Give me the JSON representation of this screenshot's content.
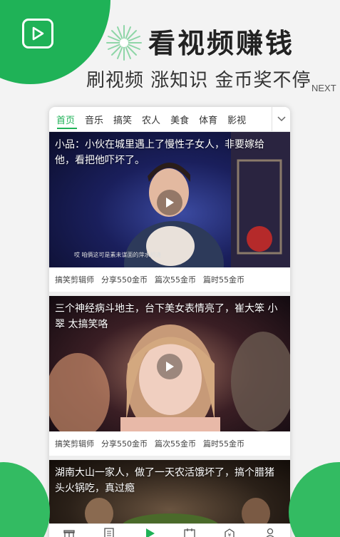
{
  "promo": {
    "headline": "看视频赚钱",
    "subline": "刷视频 涨知识 金币奖不停",
    "next_label": "NEXT"
  },
  "icons": {
    "app": "play-square-icon",
    "burst": "sparkle-burst-icon",
    "more": "chevron-down-icon",
    "play": "play-icon"
  },
  "colors": {
    "accent": "#1fb257",
    "text": "#333333"
  },
  "tabs": [
    {
      "label": "首页",
      "active": true
    },
    {
      "label": "音乐"
    },
    {
      "label": "搞笑"
    },
    {
      "label": "农人"
    },
    {
      "label": "美食"
    },
    {
      "label": "体育"
    },
    {
      "label": "影视"
    }
  ],
  "videos": [
    {
      "title": "小品：小伙在城里遇上了慢性子女人，非要嫁给他，看把他吓坏了。",
      "caption": "哎 咱俩这可是素未谋面的萍水相逢",
      "author": "搞笑剪辑师",
      "share": "分享550金币",
      "views": "篇次55金币",
      "duration": "篇时55金币"
    },
    {
      "title": "三个神经病斗地主，台下美女表情亮了，崔大笨 小翠 太搞笑咯",
      "author": "搞笑剪辑师",
      "share": "分享550金币",
      "views": "篇次55金币",
      "duration": "篇时55金币"
    },
    {
      "title": "湖南大山一家人，做了一天农活饿坏了，搞个腊猪头火锅吃，真过瘾"
    }
  ],
  "bottom_nav": [
    "gift-icon",
    "list-icon",
    "play-icon",
    "task-icon",
    "coin-icon",
    "profile-icon"
  ]
}
